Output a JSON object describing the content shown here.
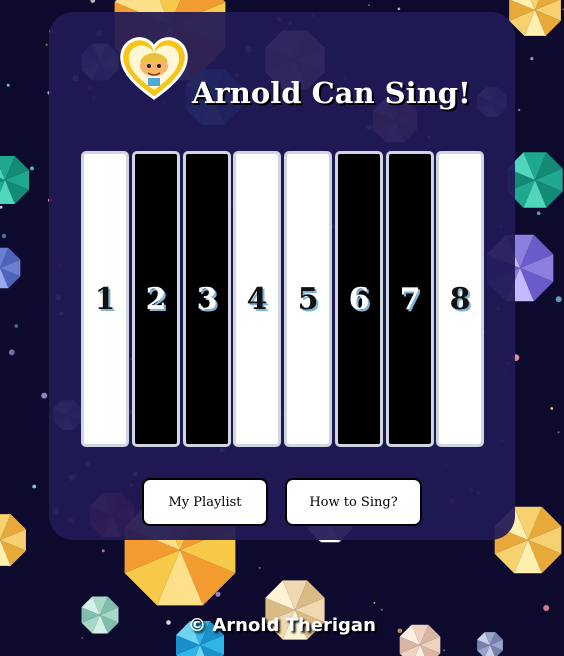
{
  "app": {
    "title": "Arnold Can Sing!"
  },
  "keys": [
    {
      "label": "1",
      "color": "white"
    },
    {
      "label": "2",
      "color": "black"
    },
    {
      "label": "3",
      "color": "black"
    },
    {
      "label": "4",
      "color": "white"
    },
    {
      "label": "5",
      "color": "white"
    },
    {
      "label": "6",
      "color": "black"
    },
    {
      "label": "7",
      "color": "black"
    },
    {
      "label": "8",
      "color": "white"
    }
  ],
  "buttons": {
    "playlist": "My Playlist",
    "how_to": "How to Sing?"
  },
  "footer": {
    "copyright": "© Arnold Therigan"
  },
  "icons": {
    "logo": "heart-portrait-icon"
  },
  "colors": {
    "background": "#0d0a2e",
    "panel": "#201a56",
    "key_border": "#cfd6e0"
  }
}
